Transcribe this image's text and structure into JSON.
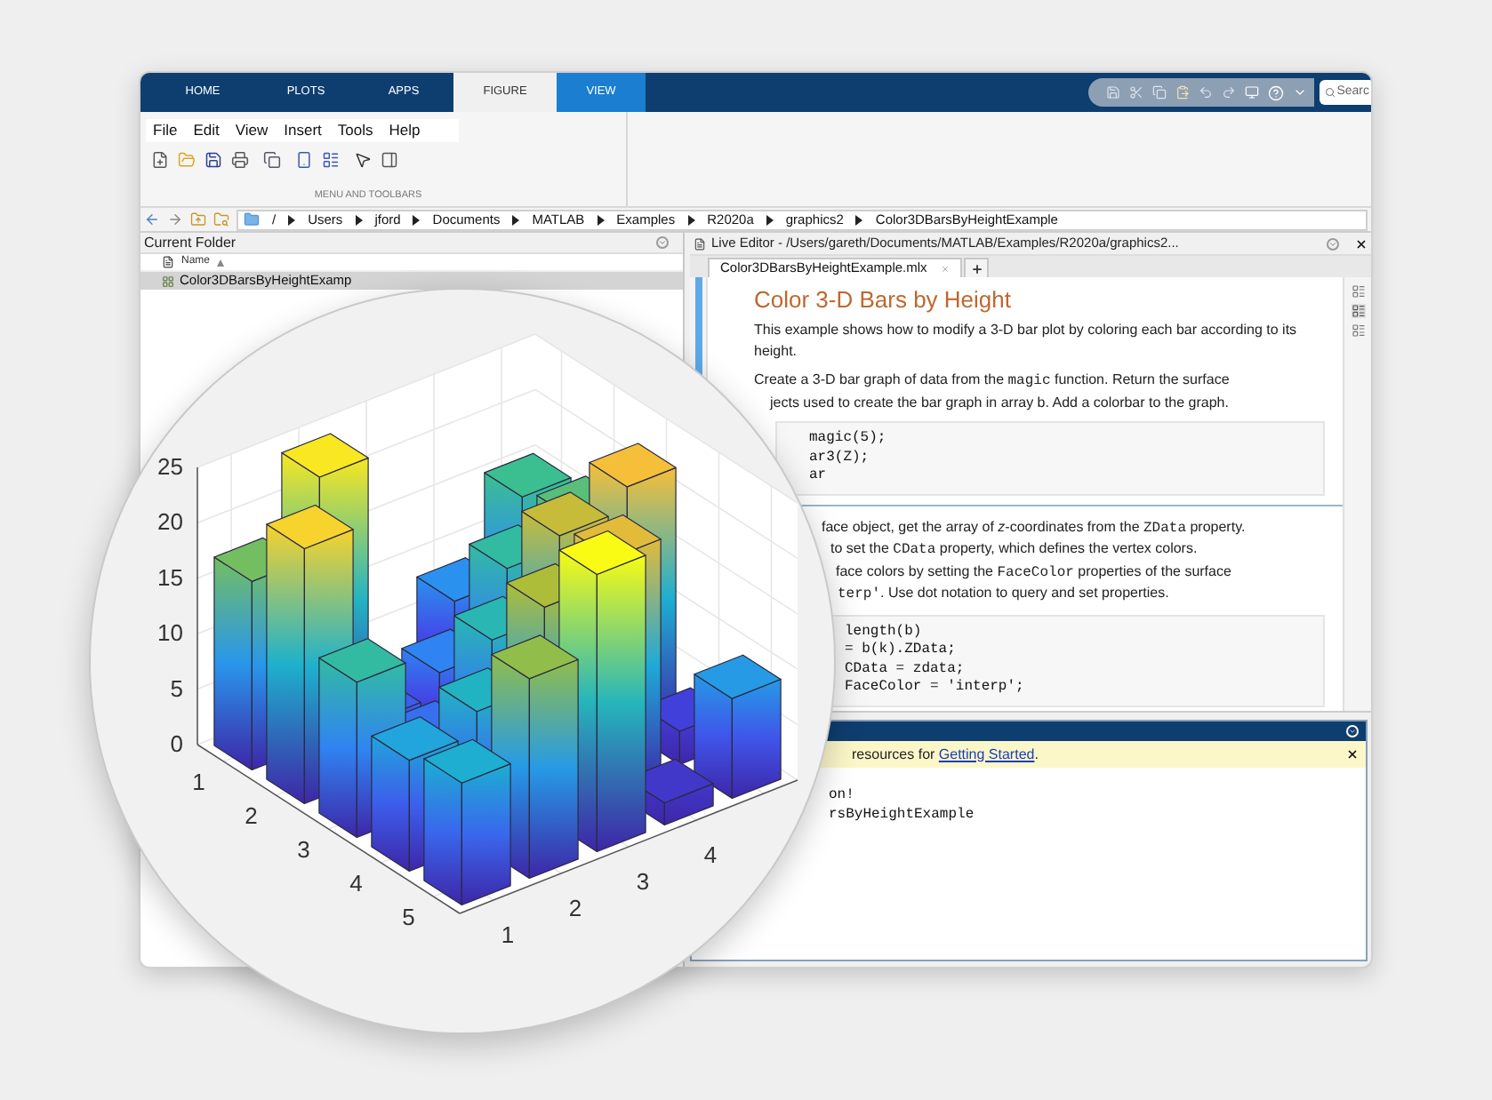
{
  "toolstrip": {
    "tabs": [
      {
        "label": "HOME",
        "selected": false,
        "kind": "standard"
      },
      {
        "label": "PLOTS",
        "selected": false,
        "kind": "standard"
      },
      {
        "label": "APPS",
        "selected": false,
        "kind": "standard"
      },
      {
        "label": "FIGURE",
        "selected": true,
        "kind": "standard"
      },
      {
        "label": "VIEW",
        "selected": false,
        "kind": "contextual"
      }
    ],
    "search": {
      "text": "Searc"
    }
  },
  "ribbon": {
    "menu": [
      "File",
      "Edit",
      "View",
      "Insert",
      "Tools",
      "Help"
    ],
    "section_label": "MENU AND TOOLBARS"
  },
  "address_bar": {
    "path": [
      "/",
      "Users",
      "jford",
      "Documents",
      "MATLAB",
      "Examples",
      "R2020a",
      "graphics2",
      "Color3DBarsByHeightExample"
    ]
  },
  "current_folder": {
    "title": "Current Folder",
    "column": "Name",
    "rows": [
      {
        "name": "Color3DBarsByHeightExamp",
        "selected": true
      }
    ]
  },
  "live_editor": {
    "title": "Live Editor - /Users/gareth/Documents/MATLAB/Examples/R2020a/graphics2...",
    "tabs": [
      {
        "label": "Color3DBarsByHeightExample.mlx",
        "selected": true
      }
    ],
    "blocks": [
      {
        "kind": "heading",
        "text": "Color 3-D Bars by Height"
      },
      {
        "kind": "paragraph",
        "text": "This example shows how to modify a 3-D bar plot by coloring each bar according to its height."
      },
      {
        "kind": "lines",
        "lines": [
          [
            {
              "kind": "plain",
              "text": "Create a 3-D bar graph of data from the "
            },
            {
              "kind": "code",
              "text": "magic"
            },
            {
              "kind": "plain",
              "text": " function. Return the surface"
            }
          ],
          [
            {
              "kind": "plain",
              "text": "jects used to create the bar graph in array b. Add a colorbar to the graph."
            }
          ]
        ]
      },
      {
        "kind": "code",
        "lines": [
          "magic(5);",
          "ar3(Z);",
          "ar"
        ]
      },
      {
        "kind": "divider"
      },
      {
        "kind": "lines",
        "lines": [
          [
            {
              "kind": "plain",
              "text": "face object, get the array of *z*-coordinates from the "
            },
            {
              "kind": "code",
              "text": "ZData"
            },
            {
              "kind": "plain",
              "text": " property."
            }
          ],
          [
            {
              "kind": "plain",
              "text": "to set the "
            },
            {
              "kind": "code",
              "text": "CData"
            },
            {
              "kind": "plain",
              "text": " property, which defines the vertex colors."
            }
          ],
          [
            {
              "kind": "plain",
              "text": "face colors by setting the "
            },
            {
              "kind": "code",
              "text": "FaceColor"
            },
            {
              "kind": "plain",
              "text": " properties of the surface"
            }
          ],
          [
            {
              "kind": "code",
              "text": "terp'"
            },
            {
              "kind": "plain",
              "text": ". Use dot notation to query and set properties."
            }
          ]
        ]
      },
      {
        "kind": "code",
        "lines": [
          "length(b)",
          "= b(k).ZData;",
          "CData = zdata;",
          "FaceColor = 'interp';"
        ]
      }
    ]
  },
  "command_window": {
    "notice": {
      "text": "resources for ",
      "link": "Getting Started",
      "after": "."
    },
    "lines": [
      "on!",
      "rsByHeightExample"
    ]
  },
  "chart": {
    "z_ticks": [
      "25",
      "20",
      "15",
      "10",
      "5",
      "0"
    ],
    "row_ticks": [
      "1",
      "2",
      "3",
      "4",
      "5"
    ],
    "column_ticks": [
      "1",
      "2",
      "3",
      "4"
    ]
  }
}
